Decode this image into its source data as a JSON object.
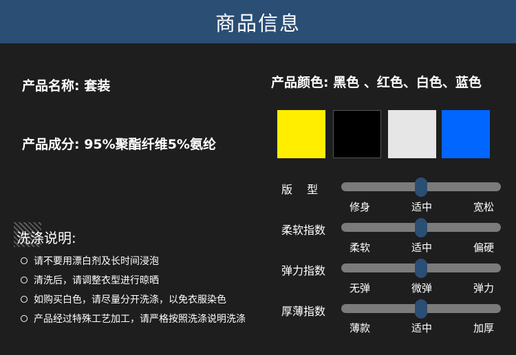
{
  "header": {
    "title": "商品信息"
  },
  "product": {
    "name_line": "产品名称: 套装",
    "material_line": "产品成分: 95%聚酯纤维5%氨纶",
    "colors_line": "产品颜色: 黑色 、红色、白色、蓝色"
  },
  "swatches": [
    {
      "name": "yellow",
      "color": "#ffee00"
    },
    {
      "name": "black",
      "color": "#000000"
    },
    {
      "name": "white",
      "color": "#e6e6e6"
    },
    {
      "name": "blue",
      "color": "#0066ff"
    }
  ],
  "care": {
    "title": "洗涤说明:",
    "items": [
      "请不要用漂白剂及长时间浸泡",
      "清洗后，请调整衣型进行晾晒",
      "如购买白色，请尽量分开洗涤，以免衣服染色",
      "产品经过特殊工艺加工，请严格按照洗涤说明洗涤"
    ]
  },
  "sliders": [
    {
      "label": "版　 型",
      "ticks": [
        "修身",
        "适中",
        "宽松"
      ],
      "value_fraction": 0.5
    },
    {
      "label": "柔软指数",
      "ticks": [
        "柔软",
        "适中",
        "偏硬"
      ],
      "value_fraction": 0.5
    },
    {
      "label": "弹力指数",
      "ticks": [
        "无弹",
        "微弹",
        "弹力"
      ],
      "value_fraction": 0.5
    },
    {
      "label": "厚薄指数",
      "ticks": [
        "薄款",
        "适中",
        "加厚"
      ],
      "value_fraction": 0.5
    }
  ],
  "colors": {
    "header_bg": "#2b4e75",
    "thumb": "#2b4e75",
    "track": "#7b7b7b"
  }
}
